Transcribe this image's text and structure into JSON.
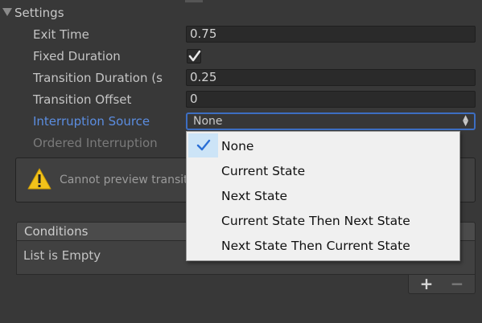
{
  "section": {
    "title": "Settings"
  },
  "settings": {
    "exit_time": {
      "label": "Exit Time",
      "value": "0.75"
    },
    "fixed_duration": {
      "label": "Fixed Duration",
      "checked": true
    },
    "transition_duration": {
      "label": "Transition Duration (s",
      "value": "0.25"
    },
    "transition_offset": {
      "label": "Transition Offset",
      "value": "0"
    },
    "interruption_source": {
      "label": "Interruption Source",
      "value": "None"
    },
    "ordered_interruption": {
      "label": "Ordered Interruption"
    }
  },
  "help": {
    "text": "Cannot preview transit",
    "icon": "warning-icon"
  },
  "conditions": {
    "header": "Conditions",
    "empty_text": "List is Empty",
    "add_label": "+",
    "remove_label": "−"
  },
  "menu": {
    "items": [
      {
        "label": "None",
        "selected": true
      },
      {
        "label": "Current State",
        "selected": false
      },
      {
        "label": "Next State",
        "selected": false
      },
      {
        "label": "Current State Then Next State",
        "selected": false
      },
      {
        "label": "Next State Then Current State",
        "selected": false
      }
    ]
  },
  "colors": {
    "accent": "#3d6ec2",
    "label_highlight": "#5b8de0",
    "menu_selected_bg": "#cce4f7",
    "check": "#2a6fd6"
  }
}
